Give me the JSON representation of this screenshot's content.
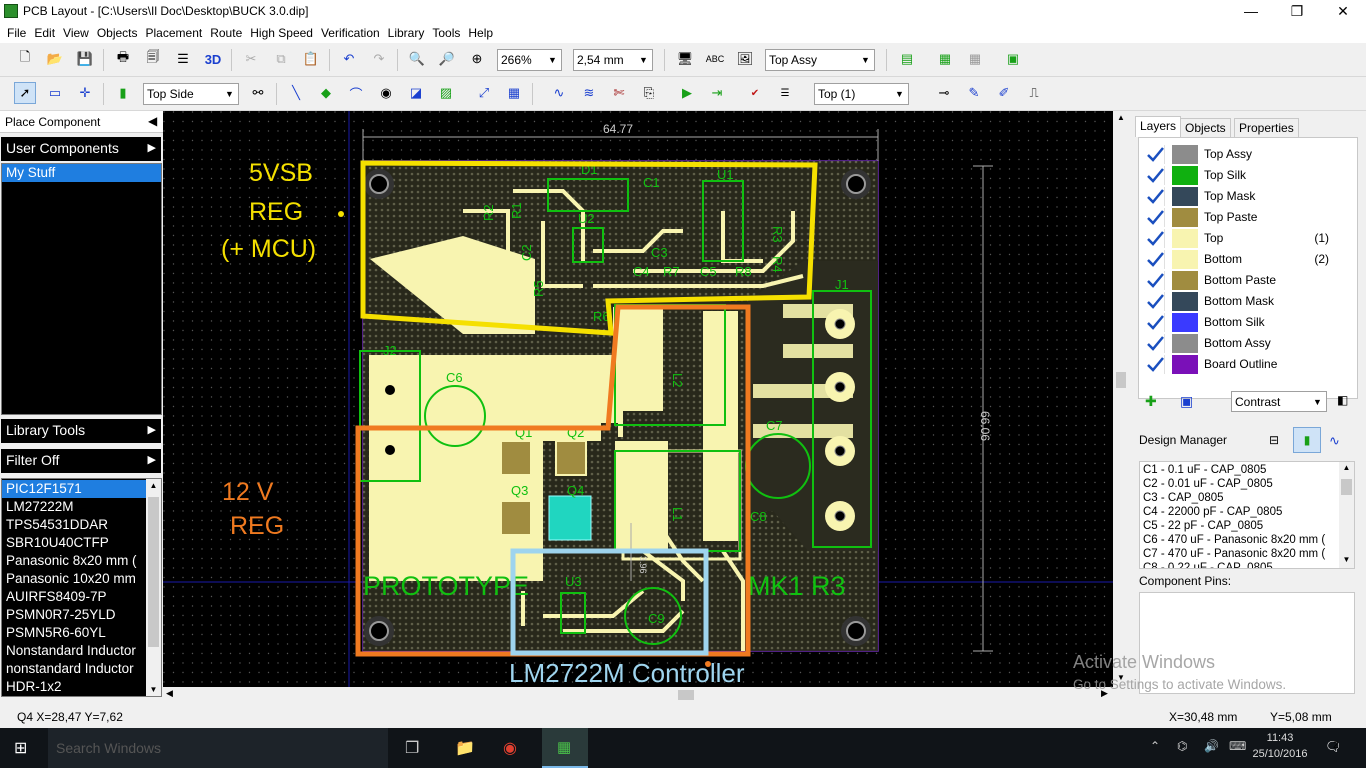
{
  "window": {
    "title": "PCB Layout - [C:\\Users\\Il Doc\\Desktop\\BUCK 3.0.dip]",
    "minimize": "—",
    "restore": "❐",
    "close": "✕"
  },
  "menu": [
    "File",
    "Edit",
    "View",
    "Objects",
    "Placement",
    "Route",
    "High Speed",
    "Verification",
    "Library",
    "Tools",
    "Help"
  ],
  "toolbar1": {
    "zoom_value": "266%",
    "grid_value": "2,54 mm",
    "view_layer": "Top Assy",
    "label_3d": "3D"
  },
  "toolbar2": {
    "side_value": "Top Side",
    "layer_value": "Top (1)"
  },
  "left_panel": {
    "place_component": "Place Component",
    "user_components": "User Components",
    "my_stuff": "My Stuff",
    "library_tools": "Library Tools",
    "filter_off": "Filter Off",
    "parts": [
      "PIC12F1571",
      "LM27222M",
      "TPS54531DDAR",
      "SBR10U40CTFP",
      "Panasonic 8x20 mm (",
      "Panasonic 10x20 mm",
      "AUIRFS8409-7P",
      "PSMN0R7-25YLD",
      "PSMN5R6-60YL",
      "Nonstandard Inductor",
      "nonstandard Inductor",
      "HDR-1x2"
    ]
  },
  "canvas": {
    "dimension_h": "64.77",
    "dimension_v": "66.06",
    "dimension_small": "3.96",
    "annotations": {
      "fivevsb_1": "5VSB",
      "fivevsb_2": "REG",
      "fivevsb_3": "(+ MCU)",
      "twelve_1": "12 V",
      "twelve_2": "REG",
      "controller": "LM2722M Controller"
    },
    "silk_text": {
      "prototype": "PROTOTYPE",
      "mk": "MK1  R3"
    },
    "refdes": [
      "D1",
      "C1",
      "U1",
      "R2",
      "R1",
      "U2",
      "R3",
      "C2",
      "C3",
      "R4",
      "R5",
      "C4",
      "R7",
      "C5",
      "R8",
      "R6",
      "J1",
      "J2",
      "C6",
      "L2",
      "C7",
      "Q1",
      "Q2",
      "Q3",
      "Q4",
      "L1",
      "C8",
      "U3",
      "C9"
    ],
    "colors": {
      "background": "#000000",
      "copper": "#f8f4b0",
      "silk": "#10c010",
      "yellow_box": "#f5e000",
      "orange_box": "#f07a20",
      "blue_box": "#9ed4ee",
      "selected_part": "#20d6c0",
      "board_outline": "#6b2bb0"
    }
  },
  "right_panel": {
    "tabs": [
      "Layers",
      "Objects",
      "Properties"
    ],
    "layers": [
      {
        "name": "Top Assy",
        "num": "",
        "color": "#8c8c8c"
      },
      {
        "name": "Top Silk",
        "num": "",
        "color": "#10b010"
      },
      {
        "name": "Top Mask",
        "num": "",
        "color": "#34485a"
      },
      {
        "name": "Top Paste",
        "num": "",
        "color": "#a08c40"
      },
      {
        "name": "Top",
        "num": "(1)",
        "color": "#f8f4b0"
      },
      {
        "name": "Bottom",
        "num": "(2)",
        "color": "#f8f4b0"
      },
      {
        "name": "Bottom Paste",
        "num": "",
        "color": "#a08c40"
      },
      {
        "name": "Bottom Mask",
        "num": "",
        "color": "#34485a"
      },
      {
        "name": "Bottom Silk",
        "num": "",
        "color": "#3a3aff"
      },
      {
        "name": "Bottom Assy",
        "num": "",
        "color": "#8c8c8c"
      },
      {
        "name": "Board Outline",
        "num": "",
        "color": "#7a10b8"
      }
    ],
    "contrast": "Contrast",
    "design_manager": "Design Manager",
    "components": [
      "C1 - 0.1 uF - CAP_0805",
      "C2 - 0.01 uF - CAP_0805",
      "C3 - CAP_0805",
      "C4 - 22000 pF - CAP_0805",
      "C5 - 22 pF - CAP_0805",
      "C6 - 470 uF - Panasonic 8x20 mm (",
      "C7 - 470 uF - Panasonic 8x20 mm (",
      "C8 - 0.22 uF - CAP_0805"
    ],
    "component_pins": "Component Pins:"
  },
  "status": {
    "left": "Q4  X=28,47  Y=7,62",
    "x": "X=30,48 mm",
    "y": "Y=5,08 mm"
  },
  "watermark": {
    "line1": "Activate Windows",
    "line2": "Go to Settings to activate Windows."
  },
  "taskbar": {
    "search": "Search Windows",
    "time": "11:43",
    "date": "25/10/2016",
    "notifications": "2"
  }
}
